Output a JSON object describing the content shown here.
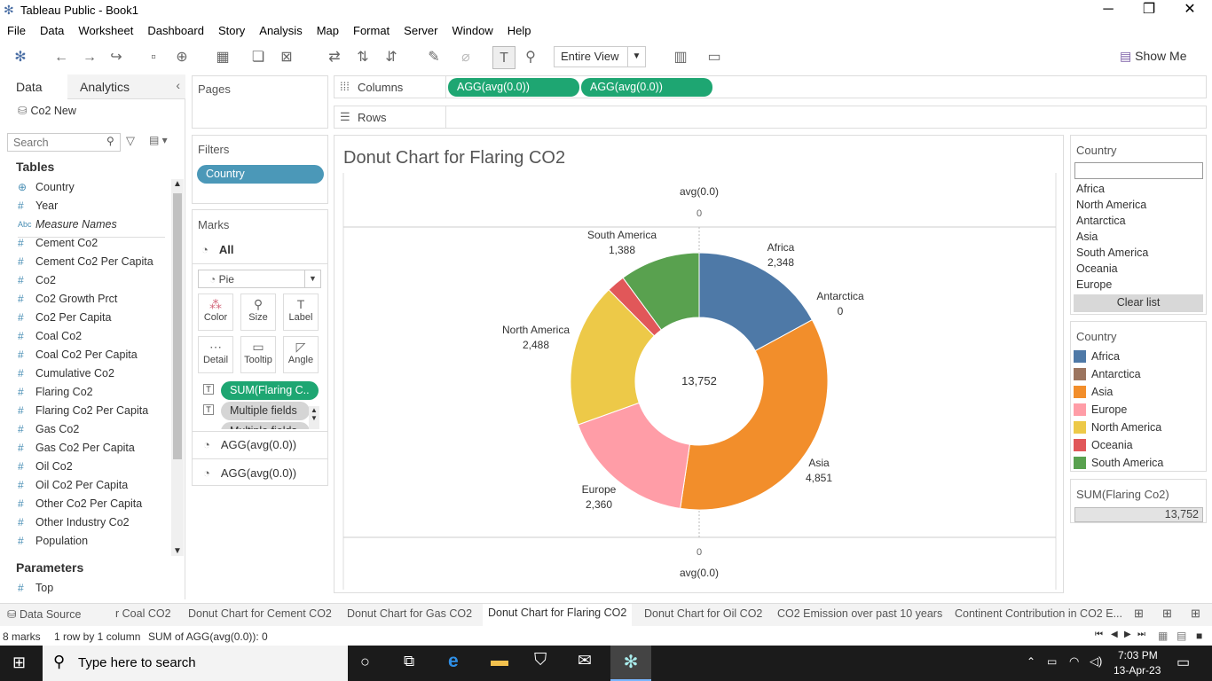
{
  "window": {
    "title": "Tableau Public - Book1"
  },
  "menu": [
    "File",
    "Data",
    "Worksheet",
    "Dashboard",
    "Story",
    "Analysis",
    "Map",
    "Format",
    "Server",
    "Window",
    "Help"
  ],
  "toolbar": {
    "fit_value": "Entire View",
    "show_me": "Show Me"
  },
  "left": {
    "tab_data": "Data",
    "tab_analytics": "Analytics",
    "datasource": "Co2 New",
    "search_placeholder": "Search",
    "tables_heading": "Tables",
    "fields": [
      {
        "icon": "globe",
        "name": "Country"
      },
      {
        "icon": "#",
        "name": "Year"
      },
      {
        "icon": "Abc",
        "name": "Measure Names"
      },
      {
        "icon": "#",
        "name": "Cement Co2"
      },
      {
        "icon": "#",
        "name": "Cement Co2 Per Capita"
      },
      {
        "icon": "#",
        "name": "Co2"
      },
      {
        "icon": "#",
        "name": "Co2 Growth Prct"
      },
      {
        "icon": "#",
        "name": "Co2 Per Capita"
      },
      {
        "icon": "#",
        "name": "Coal Co2"
      },
      {
        "icon": "#",
        "name": "Coal Co2 Per Capita"
      },
      {
        "icon": "#",
        "name": "Cumulative Co2"
      },
      {
        "icon": "#",
        "name": "Flaring Co2"
      },
      {
        "icon": "#",
        "name": "Flaring Co2 Per Capita"
      },
      {
        "icon": "#",
        "name": "Gas Co2"
      },
      {
        "icon": "#",
        "name": "Gas Co2 Per Capita"
      },
      {
        "icon": "#",
        "name": "Oil Co2"
      },
      {
        "icon": "#",
        "name": "Oil Co2 Per Capita"
      },
      {
        "icon": "#",
        "name": "Other Co2 Per Capita"
      },
      {
        "icon": "#",
        "name": "Other Industry Co2"
      },
      {
        "icon": "#",
        "name": "Population"
      }
    ],
    "parameters_heading": "Parameters",
    "parameters": [
      {
        "icon": "#",
        "name": "Top"
      }
    ]
  },
  "pages": {
    "label": "Pages"
  },
  "filters": {
    "label": "Filters",
    "pill": "Country"
  },
  "marks": {
    "label": "Marks",
    "all": "All",
    "type": "Pie",
    "buttons": [
      "Color",
      "Size",
      "Label",
      "Detail",
      "Tooltip",
      "Angle"
    ],
    "fields": [
      "SUM(Flaring C..",
      "Multiple fields",
      "Multiple fields"
    ],
    "agg1": "AGG(avg(0.0))",
    "agg2": "AGG(avg(0.0))"
  },
  "shelves": {
    "columns_label": "Columns",
    "columns_pills": [
      "AGG(avg(0.0))",
      "AGG(avg(0.0))"
    ],
    "rows_label": "Rows"
  },
  "sheet": {
    "title": "Donut Chart for Flaring CO2",
    "top_axis_title": "avg(0.0)",
    "top_axis_tick": "0",
    "bottom_axis_tick": "0",
    "bottom_axis_title": "avg(0.0)",
    "center_total": "13,752"
  },
  "chart_data": {
    "type": "pie",
    "title": "Donut Chart for Flaring CO2",
    "categories": [
      "Africa",
      "Antarctica",
      "Asia",
      "Europe",
      "North America",
      "Oceania",
      "South America"
    ],
    "values": [
      2348,
      0,
      4851,
      2360,
      2488,
      317,
      1388
    ],
    "labels": [
      "2,348",
      "0",
      "4,851",
      "2,360",
      "2,488",
      "",
      "1,388"
    ],
    "colors": [
      "#4e79a7",
      "#9c755f",
      "#f28e2b",
      "#ff9da7",
      "#edc948",
      "#e15759",
      "#59a14f"
    ],
    "total": "13,752",
    "legend_position": "right"
  },
  "country_filter": {
    "title": "Country",
    "items": [
      "Africa",
      "North America",
      "Antarctica",
      "Asia",
      "South America",
      "Oceania",
      "Europe"
    ],
    "clear": "Clear list"
  },
  "legend": {
    "title": "Country",
    "items": [
      {
        "name": "Africa",
        "color": "#4e79a7"
      },
      {
        "name": "Antarctica",
        "color": "#9c755f"
      },
      {
        "name": "Asia",
        "color": "#f28e2b"
      },
      {
        "name": "Europe",
        "color": "#ff9da7"
      },
      {
        "name": "North America",
        "color": "#edc948"
      },
      {
        "name": "Oceania",
        "color": "#e15759"
      },
      {
        "name": "South America",
        "color": "#59a14f"
      }
    ]
  },
  "size_legend": {
    "title": "SUM(Flaring Co2)",
    "value": "13,752"
  },
  "sheet_tabs": [
    "Data Source",
    "r Coal CO2",
    "Donut Chart for Cement CO2",
    "Donut Chart for Gas CO2",
    "Donut Chart for Flaring CO2",
    "Donut Chart for Oil CO2",
    "CO2 Emission over past 10 years",
    "Continent Contribution in CO2 E..."
  ],
  "status": {
    "marks": "8 marks",
    "dims": "1 row by 1 column",
    "sum": "SUM of AGG(avg(0.0)): 0"
  },
  "taskbar": {
    "search": "Type here to search",
    "time": "7:03 PM",
    "date": "13-Apr-23"
  }
}
